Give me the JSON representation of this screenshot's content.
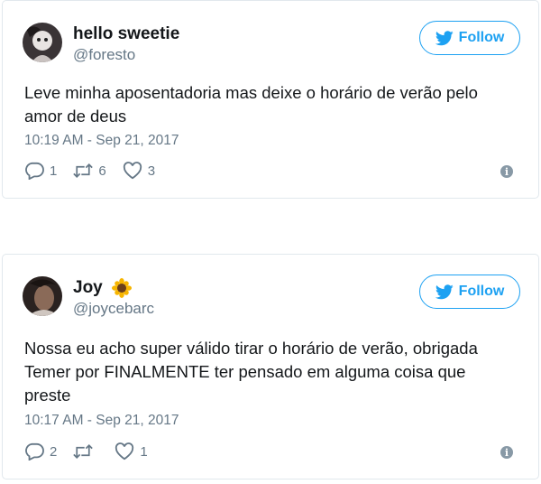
{
  "accent_color": "#1da1f2",
  "tweets": [
    {
      "name": "hello sweetie",
      "handle": "@foresto",
      "follow_label": "Follow",
      "text": "Leve minha aposentadoria mas deixe o horário de verão pelo\namor de deus",
      "timestamp": "10:19 AM - Sep 21, 2017",
      "replies": "1",
      "retweets": "6",
      "likes": "3",
      "info_icon": "info-icon"
    },
    {
      "name": "Joy",
      "name_emoji": "sunflower-emoji",
      "handle": "@joycebarc",
      "follow_label": "Follow",
      "text": "Nossa eu acho super válido tirar o horário de verão, obrigada\nTemer por FINALMENTE ter pensado em alguma coisa que\npreste",
      "timestamp": "10:17 AM - Sep 21, 2017",
      "replies": "2",
      "retweets": "",
      "likes": "1",
      "info_icon": "info-icon"
    }
  ]
}
